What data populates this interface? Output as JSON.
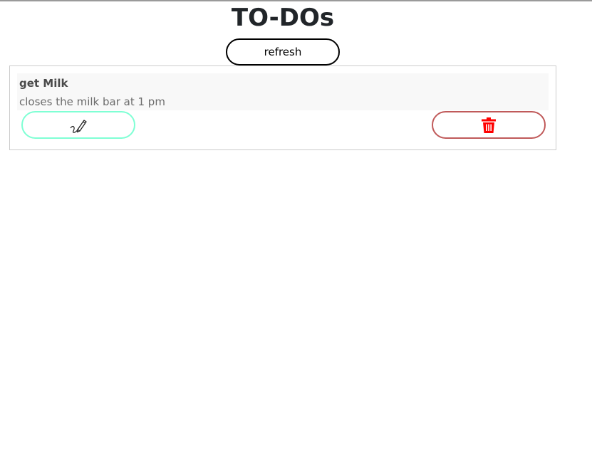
{
  "app": {
    "title": "TO-DOs",
    "refresh_label": "refresh"
  },
  "todos": [
    {
      "title": "get Milk",
      "description": "closes the milk bar at 1 pm",
      "edit_icon": "pencil-icon",
      "delete_icon": "trash-icon"
    }
  ],
  "colors": {
    "edit_border": "#7fffd4",
    "delete_border": "#c05a5a",
    "delete_icon": "#ff0000"
  }
}
